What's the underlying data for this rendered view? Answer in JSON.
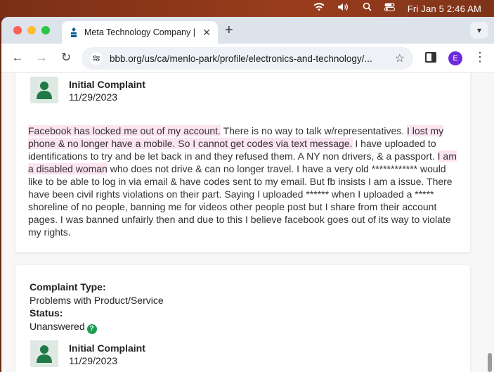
{
  "menubar": {
    "clock": "Fri Jan 5  2:46 AM",
    "icons": [
      "wifi-icon",
      "volume-icon",
      "search-icon",
      "control-center-icon"
    ]
  },
  "browser": {
    "tab_title": "Meta Technology Company | C",
    "url": "bbb.org/us/ca/menlo-park/profile/electronics-and-technology/...",
    "profile_initial": "E"
  },
  "complaint1": {
    "title": "Initial Complaint",
    "date": "11/29/2023",
    "segments": [
      {
        "text": "Facebook has locked me out of my account.",
        "hl": true
      },
      {
        "text": " There is no way to talk w/representatives. ",
        "hl": false
      },
      {
        "text": "I lost my phone & no longer have a mobile. So I cannot get codes via text message.",
        "hl": true
      },
      {
        "text": " I have uploaded to identifications to try and be let back in and they refused them. A NY non drivers, & a passport. ",
        "hl": false
      },
      {
        "text": "I am a disabled woman",
        "hl": true
      },
      {
        "text": " who does not drive & can no longer travel. I have a very old ************ would like to be able to log in via email & have codes sent to my email. But fb insists I am a issue. There have been civil rights violations on their part. Saying I uploaded ****** when I uploaded a ***** shoreline of no people, banning me for videos other people post but I share from their account pages. I was banned unfairly then and due to this I believe facebook goes out of its way to violate my rights.",
        "hl": false
      }
    ]
  },
  "complaint2": {
    "type_label": "Complaint Type:",
    "type_value": "Problems with Product/Service",
    "status_label": "Status:",
    "status_value": "Unanswered",
    "help_glyph": "?",
    "title": "Initial Complaint",
    "date": "11/29/2023"
  },
  "colors": {
    "highlight": "#fce4f0",
    "avatar_bg": "#dfe9e3",
    "avatar_fg": "#1f7a4a",
    "status_help": "#1f9d55"
  }
}
